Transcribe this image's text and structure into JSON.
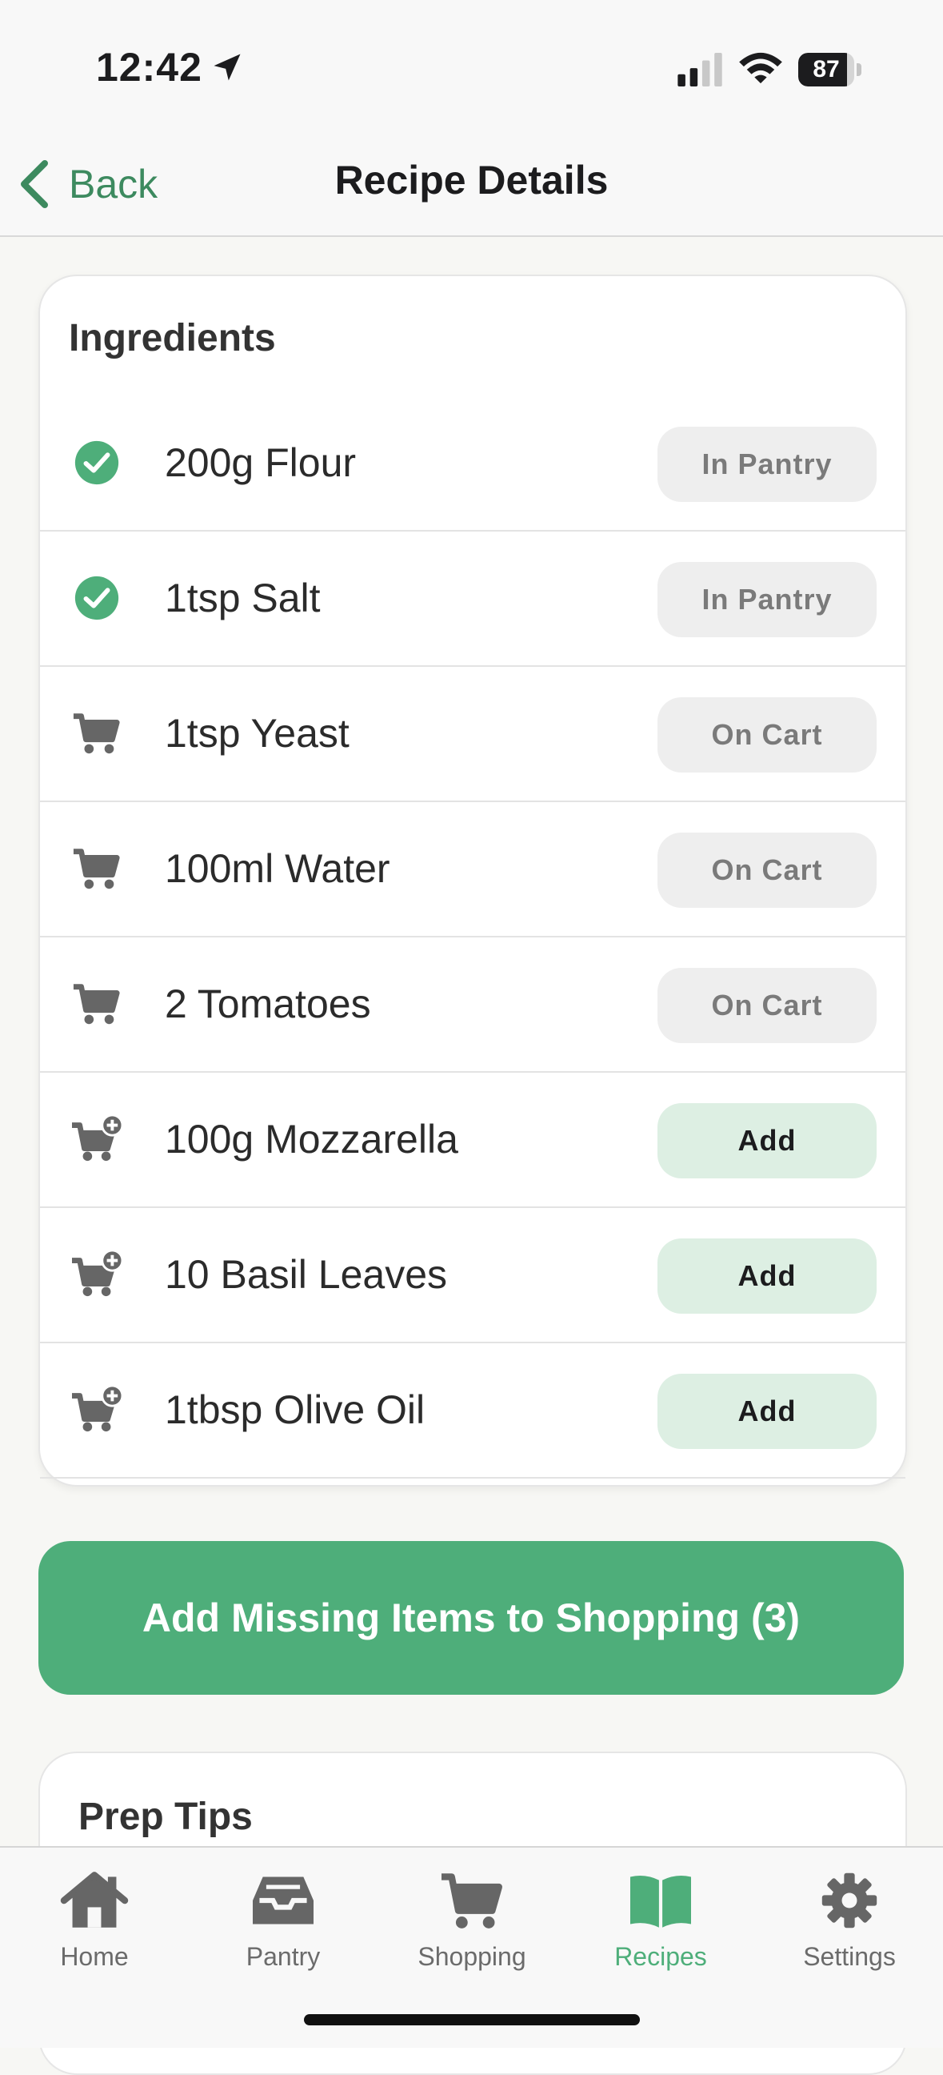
{
  "status_bar": {
    "time": "12:42",
    "battery": "87",
    "battery_level": 0.87
  },
  "nav": {
    "back_label": "Back",
    "title": "Recipe Details"
  },
  "ingredients": {
    "title": "Ingredients",
    "items": [
      {
        "name": "200g Flour",
        "status": "In Pantry",
        "icon": "check-circle-icon"
      },
      {
        "name": "1tsp Salt",
        "status": "In Pantry",
        "icon": "check-circle-icon"
      },
      {
        "name": "1tsp Yeast",
        "status": "On Cart",
        "icon": "cart-icon"
      },
      {
        "name": "100ml Water",
        "status": "On Cart",
        "icon": "cart-icon"
      },
      {
        "name": "2 Tomatoes",
        "status": "On Cart",
        "icon": "cart-icon"
      },
      {
        "name": "100g Mozzarella",
        "status": "Add",
        "icon": "cart-plus-icon"
      },
      {
        "name": "10 Basil Leaves",
        "status": "Add",
        "icon": "cart-plus-icon"
      },
      {
        "name": "1tbsp Olive Oil",
        "status": "Add",
        "icon": "cart-plus-icon"
      }
    ]
  },
  "cta": {
    "label": "Add Missing Items to Shopping (3)"
  },
  "prep_tips": {
    "title": "Prep Tips"
  },
  "tabs": [
    {
      "label": "Home",
      "icon": "home-icon",
      "active": false
    },
    {
      "label": "Pantry",
      "icon": "inbox-tray-icon",
      "active": false
    },
    {
      "label": "Shopping",
      "icon": "cart-icon",
      "active": false
    },
    {
      "label": "Recipes",
      "icon": "book-icon",
      "active": true
    },
    {
      "label": "Settings",
      "icon": "gear-icon",
      "active": false
    }
  ],
  "colors": {
    "accent": "#4eae7a",
    "accent_light": "#ddefe3",
    "back_text": "#3d8a5f",
    "pill_gray": "#eeeeee"
  }
}
